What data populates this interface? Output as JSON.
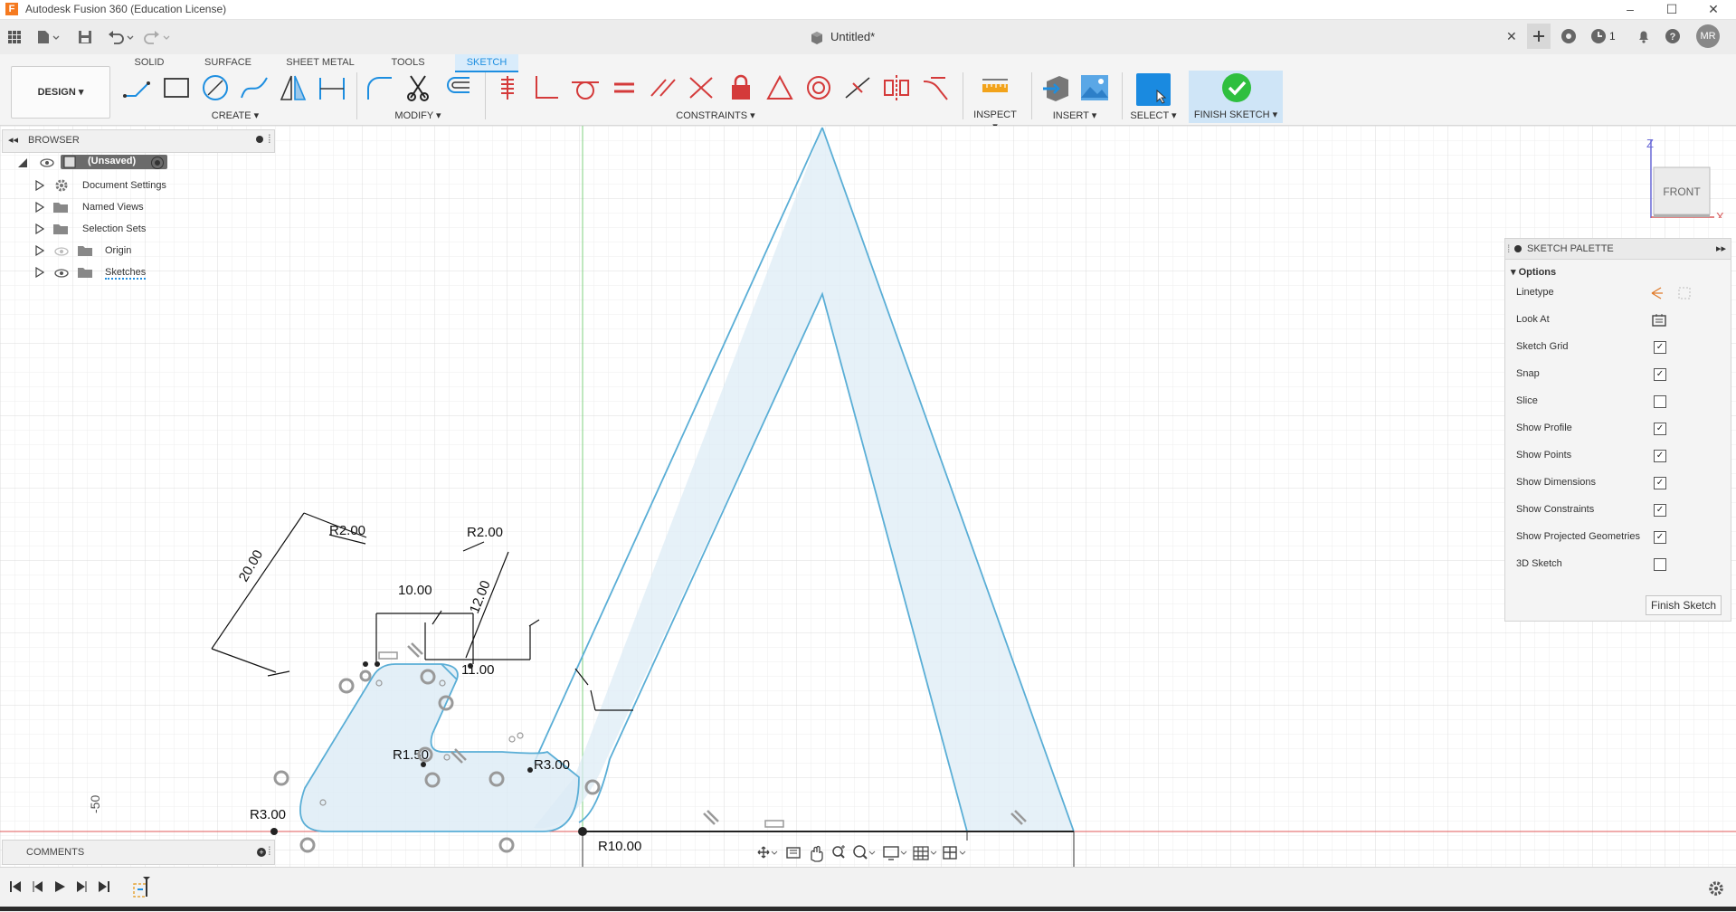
{
  "window": {
    "app_title": "Autodesk Fusion 360 (Education License)",
    "app_icon_letter": "F",
    "minimize": "–",
    "maximize": "☐",
    "close": "✕"
  },
  "quick_access": {
    "doc_title": "Untitled*",
    "close_tab": "✕",
    "job_count": "1",
    "user_initials": "MR"
  },
  "ribbon": {
    "tabs": [
      "SOLID",
      "SURFACE",
      "SHEET METAL",
      "TOOLS",
      "SKETCH"
    ],
    "active_tab": "SKETCH",
    "workspace": "DESIGN ▾",
    "groups": {
      "create": "CREATE ▾",
      "modify": "MODIFY ▾",
      "constraints": "CONSTRAINTS ▾",
      "inspect": "INSPECT ▾",
      "insert": "INSERT ▾",
      "select": "SELECT ▾",
      "finish_sketch": "FINISH SKETCH ▾"
    }
  },
  "browser": {
    "header": "BROWSER",
    "items": [
      {
        "label": "(Unsaved)"
      },
      {
        "label": "Document Settings"
      },
      {
        "label": "Named Views"
      },
      {
        "label": "Selection Sets"
      },
      {
        "label": "Origin"
      },
      {
        "label": "Sketches"
      }
    ]
  },
  "comments": {
    "header": "COMMENTS"
  },
  "view_cube": {
    "face": "FRONT",
    "z_label": "Z",
    "x_label": "X"
  },
  "sketch_palette": {
    "header": "SKETCH PALETTE",
    "section": "Options",
    "rows": [
      {
        "label": "Linetype",
        "kind": "icons"
      },
      {
        "label": "Look At",
        "kind": "icon"
      },
      {
        "label": "Sketch Grid",
        "checked": true
      },
      {
        "label": "Snap",
        "checked": true
      },
      {
        "label": "Slice",
        "checked": false
      },
      {
        "label": "Show Profile",
        "checked": true
      },
      {
        "label": "Show Points",
        "checked": true
      },
      {
        "label": "Show Dimensions",
        "checked": true
      },
      {
        "label": "Show Constraints",
        "checked": true
      },
      {
        "label": "Show Projected Geometries",
        "checked": true
      },
      {
        "label": "3D Sketch",
        "checked": false
      }
    ],
    "finish_button": "Finish Sketch"
  },
  "dimensions": {
    "d_10": "10.00",
    "d_20": "20.00",
    "d_12": "12.00",
    "d_11": "11.00",
    "r2a": "R2.00",
    "r2b": "R2.00",
    "r150": "R1.50",
    "r3a": "R3.00",
    "r3b": "R3.00",
    "r10": "R10.00",
    "axis_tick": "-50"
  },
  "colors": {
    "accent": "#1a8ae0",
    "profile_fill": "#dcebf5",
    "sketch_line": "#5aaed6",
    "x_axis": "#e05a5a",
    "y_axis": "#7fd07f",
    "finish_check": "#2fbf3f"
  }
}
